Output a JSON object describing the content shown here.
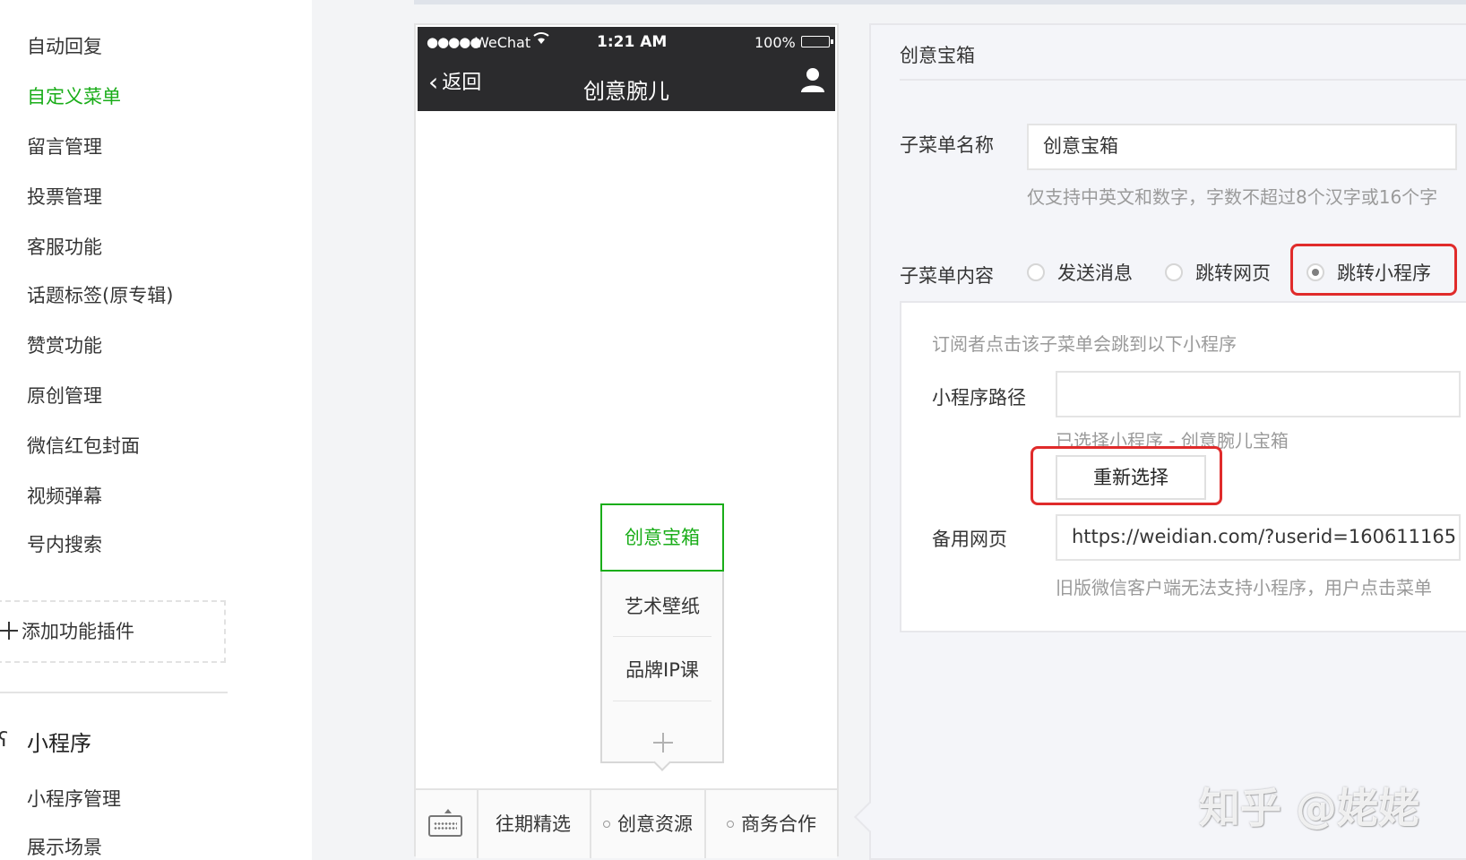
{
  "sidebar": {
    "items": [
      {
        "label": "自动回复"
      },
      {
        "label": "自定义菜单",
        "active": true
      },
      {
        "label": "留言管理"
      },
      {
        "label": "投票管理"
      },
      {
        "label": "客服功能"
      },
      {
        "label": "话题标签(原专辑)"
      },
      {
        "label": "赞赏功能"
      },
      {
        "label": "原创管理"
      },
      {
        "label": "微信红包封面"
      },
      {
        "label": "视频弹幕"
      },
      {
        "label": "号内搜索"
      }
    ],
    "add_plugin_label": "添加功能插件",
    "section_title": "小程序",
    "section_items": [
      {
        "label": "小程序管理"
      },
      {
        "label": "展示场景"
      }
    ]
  },
  "phone": {
    "status": {
      "signal": "●●●●●",
      "carrier": "WeChat",
      "time": "1:21 AM",
      "battery": "100%"
    },
    "nav": {
      "back_label": "返回",
      "title": "创意腕儿"
    },
    "submenu": {
      "active_item": "创意宝箱",
      "items": [
        "艺术壁纸",
        "品牌IP课"
      ]
    },
    "menu_tabs": [
      "往期精选",
      "创意资源",
      "商务合作"
    ]
  },
  "editor": {
    "title": "创意宝箱",
    "name_label": "子菜单名称",
    "name_value": "创意宝箱",
    "name_hint": "仅支持中英文和数字，字数不超过8个汉字或16个字",
    "content_label": "子菜单内容",
    "content_options": [
      {
        "label": "发送消息",
        "checked": false
      },
      {
        "label": "跳转网页",
        "checked": false
      },
      {
        "label": "跳转小程序",
        "checked": true
      }
    ],
    "miniprogram": {
      "intro": "订阅者点击该子菜单会跳到以下小程序",
      "path_label": "小程序路径",
      "path_value": "",
      "selected_text": "已选择小程序 - 创意腕儿宝箱",
      "reselect_button": "重新选择",
      "backup_label": "备用网页",
      "backup_value": "https://weidian.com/?userid=160611165",
      "backup_hint": "旧版微信客户端无法支持小程序，用户点击菜单"
    }
  },
  "watermark": "知乎 @姥姥",
  "colors": {
    "accent_green": "#1aad19",
    "highlight_red": "#e02b2b",
    "phone_header": "#2b2b2d"
  }
}
